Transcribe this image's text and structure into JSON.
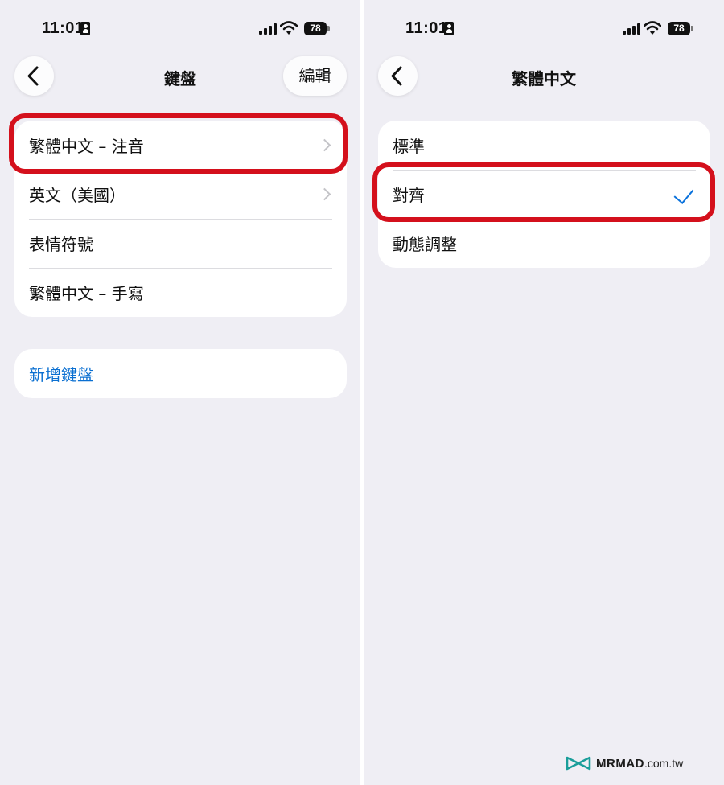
{
  "status_bar": {
    "time": "11:01",
    "battery_level": "78"
  },
  "left_screen": {
    "nav": {
      "title": "鍵盤",
      "edit_label": "編輯"
    },
    "keyboards": [
      {
        "label": "繁體中文 – 注音",
        "has_chevron": true,
        "highlighted": true
      },
      {
        "label": "英文（美國）",
        "has_chevron": true
      },
      {
        "label": "表情符號",
        "has_chevron": false
      },
      {
        "label": "繁體中文 – 手寫",
        "has_chevron": false
      }
    ],
    "add_keyboard_label": "新增鍵盤"
  },
  "right_screen": {
    "nav": {
      "title": "繁體中文"
    },
    "options": [
      {
        "label": "標準",
        "selected": false
      },
      {
        "label": "對齊",
        "selected": true,
        "highlighted": true
      },
      {
        "label": "動態調整",
        "selected": false
      }
    ]
  },
  "watermark": {
    "brand": "MRMAD",
    "tld": ".com.tw"
  },
  "colors": {
    "background": "#efeef4",
    "accent_blue": "#0a6fd1",
    "highlight_red": "#d4101c"
  }
}
